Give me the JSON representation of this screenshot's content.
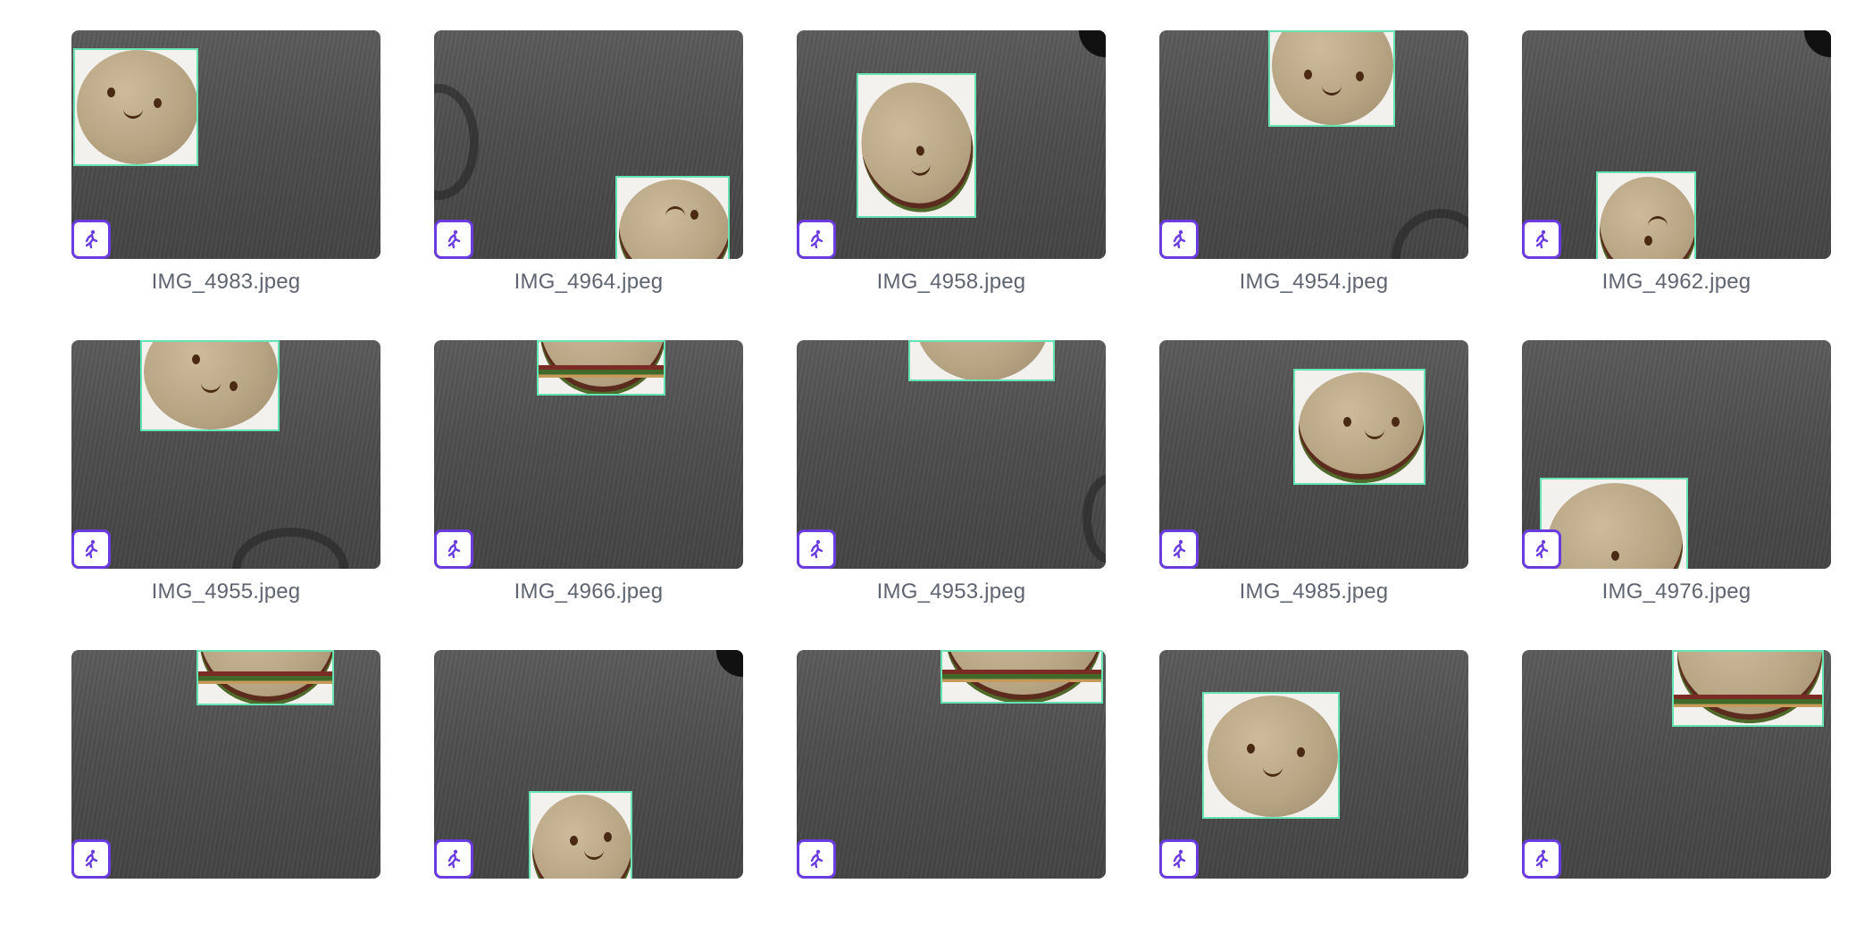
{
  "gallery": {
    "items": [
      {
        "filename": "IMG_4983.jpeg"
      },
      {
        "filename": "IMG_4964.jpeg"
      },
      {
        "filename": "IMG_4958.jpeg"
      },
      {
        "filename": "IMG_4954.jpeg"
      },
      {
        "filename": "IMG_4962.jpeg"
      },
      {
        "filename": "IMG_4955.jpeg"
      },
      {
        "filename": "IMG_4966.jpeg"
      },
      {
        "filename": "IMG_4953.jpeg"
      },
      {
        "filename": "IMG_4985.jpeg"
      },
      {
        "filename": "IMG_4976.jpeg"
      },
      {
        "filename": ""
      },
      {
        "filename": ""
      },
      {
        "filename": ""
      },
      {
        "filename": ""
      },
      {
        "filename": ""
      }
    ],
    "badge_icon": "running-person-icon",
    "colors": {
      "badge_border": "#6a3ce0",
      "bbox_outline": "#66e3b3",
      "caption_text": "#5e6470"
    }
  }
}
